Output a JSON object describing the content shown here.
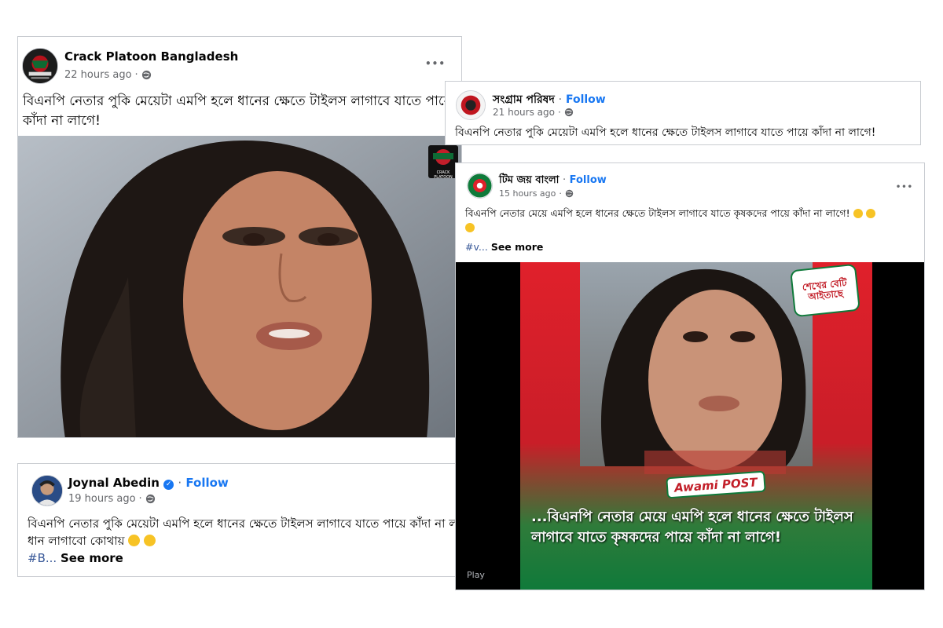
{
  "posts": [
    {
      "page_name": "Crack Platoon Bangladesh",
      "time": "22 hours ago",
      "text": "বিএনপি নেতার পুকি মেয়েটা এমপি হলে ধানের ক্ষেতে টাইলস লাগাবে যাতে পায়ে কাঁদা না লাগে!",
      "more": "•••"
    },
    {
      "page_name": "সংগ্রাম পরিষদ",
      "follow": "Follow",
      "time": "21 hours ago",
      "text": "বিএনপি নেতার পুকি মেয়েটা এমপি হলে ধানের ক্ষেতে টাইলস লাগাবে যাতে পায়ে কাঁদা না লাগে!"
    },
    {
      "page_name": "টিম জয় বাংলা",
      "follow": "Follow",
      "time": "15 hours ago",
      "text": "বিএনপি নেতার মেয়ে এমপি হলে ধানের ক্ষেতে টাইলস লাগাবে যাতে কৃষকদের পায়ে কাঁদা না লাগে!",
      "hashtag": "#v...",
      "see_more": "See more",
      "more": "•••",
      "overlay_caption": "...বিএনপি নেতার মেয়ে এমপি হলে ধানের ক্ষেতে টাইলস লাগাবে যাতে কৃষকদের পায়ে কাঁদা না লাগে!",
      "brand_logo": "Awami POST",
      "sticker_text": "শেখের বেটি আইতাছে",
      "play_label": "Play"
    },
    {
      "page_name": "Joynal Abedin",
      "follow": "Follow",
      "time": "19 hours ago",
      "text": "বিএনপি নেতার পুকি মেয়েটা এমপি হলে ধানের ক্ষেতে টাইলস লাগাবে যাতে পায়ে কাঁদা না লাগে!",
      "text2": "ধান লাগাবো কোথায়",
      "hashtag": "#B...",
      "see_more": "See more"
    }
  ],
  "watermark": "CRACK PLATOON",
  "colors": {
    "facebook_blue": "#1877f2",
    "meta_gray": "#65676b",
    "flag_red": "#e0202b",
    "flag_green": "#0f7a3a"
  },
  "icons": [
    "globe-icon",
    "more-options-icon",
    "verified-badge-icon",
    "emoji-icon"
  ]
}
